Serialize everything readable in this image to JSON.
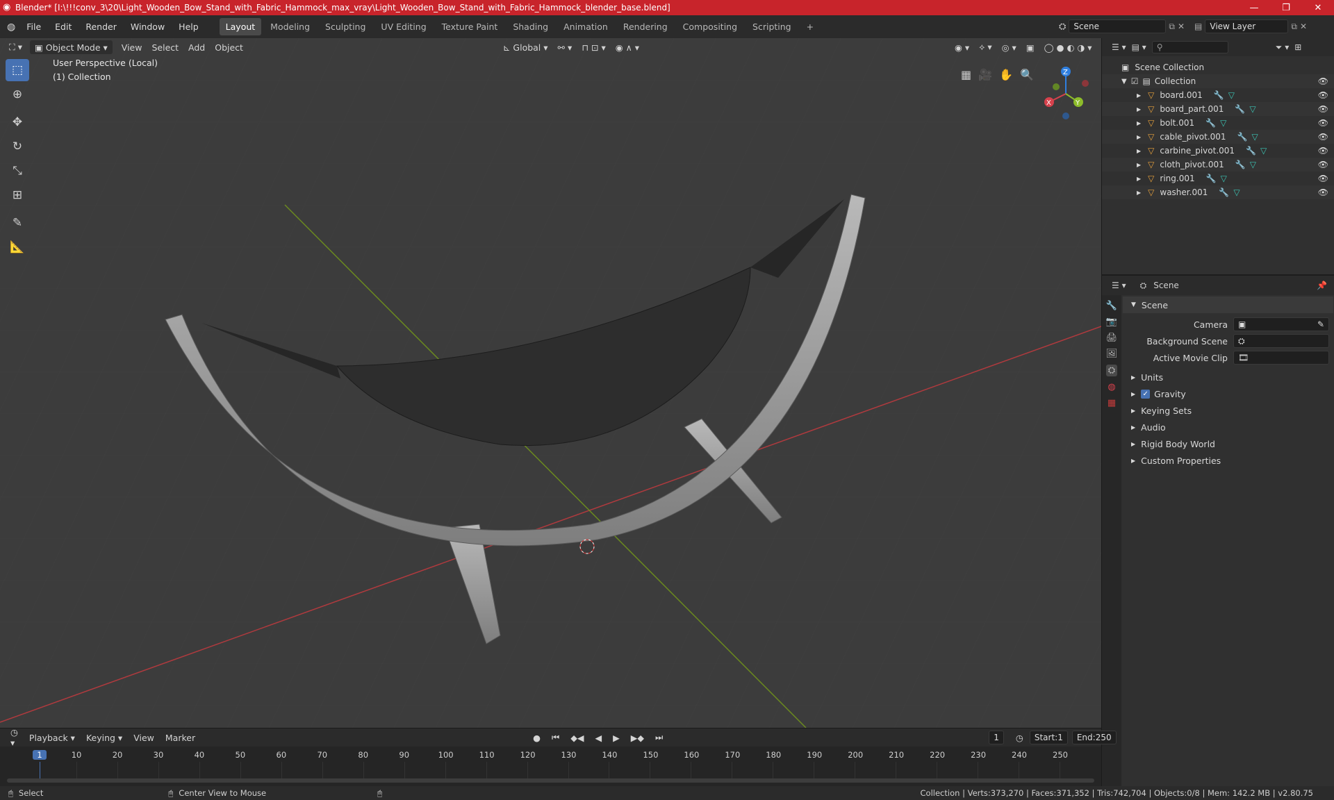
{
  "window": {
    "title": "Blender* [I:\\!!!conv_3\\20\\Light_Wooden_Bow_Stand_with_Fabric_Hammock_max_vray\\Light_Wooden_Bow_Stand_with_Fabric_Hammock_blender_base.blend]",
    "minimize": "—",
    "maximize": "❐",
    "close": "✕"
  },
  "menu": {
    "items": [
      "File",
      "Edit",
      "Render",
      "Window",
      "Help"
    ]
  },
  "workspaces": {
    "tabs": [
      "Layout",
      "Modeling",
      "Sculpting",
      "UV Editing",
      "Texture Paint",
      "Shading",
      "Animation",
      "Rendering",
      "Compositing",
      "Scripting"
    ],
    "active": "Layout",
    "add": "+"
  },
  "topright": {
    "scene": "Scene",
    "view_layer": "View Layer"
  },
  "viewport_header": {
    "mode": "Object Mode",
    "menus": [
      "View",
      "Select",
      "Add",
      "Object"
    ],
    "orientation": "Global"
  },
  "viewport": {
    "perspective": "User Perspective (Local)",
    "collection": "(1) Collection",
    "axes": {
      "x": "X",
      "y": "Y",
      "z": "Z"
    }
  },
  "colors": {
    "accent": "#4772b3",
    "x_axis": "#d6414c",
    "y_axis": "#8dbc2a",
    "z_axis": "#2f7fe0",
    "titlebar": "#c8242b",
    "mesh_icon": "#e8a23c"
  },
  "outliner": {
    "search_placeholder": "",
    "root": "Scene Collection",
    "collection": "Collection",
    "objects": [
      "board.001",
      "board_part.001",
      "bolt.001",
      "cable_pivot.001",
      "carbine_pivot.001",
      "cloth_pivot.001",
      "ring.001",
      "washer.001"
    ]
  },
  "properties": {
    "context": "Scene",
    "section": "Scene",
    "fields": [
      {
        "label": "Camera",
        "value": ""
      },
      {
        "label": "Background Scene",
        "value": ""
      },
      {
        "label": "Active Movie Clip",
        "value": ""
      }
    ],
    "panels": [
      "Units",
      "Gravity",
      "Keying Sets",
      "Audio",
      "Rigid Body World",
      "Custom Properties"
    ],
    "gravity_checked": true
  },
  "timeline": {
    "menus": [
      "Playback",
      "Keying",
      "View",
      "Marker"
    ],
    "current_frame": "1",
    "start_label": "Start:",
    "start": "1",
    "end_label": "End:",
    "end": "250",
    "ticks": [
      "1",
      "10",
      "20",
      "30",
      "40",
      "50",
      "60",
      "70",
      "80",
      "90",
      "100",
      "110",
      "120",
      "130",
      "140",
      "150",
      "160",
      "170",
      "180",
      "190",
      "200",
      "210",
      "220",
      "230",
      "240",
      "250"
    ]
  },
  "status": {
    "select": "Select",
    "center_view": "Center View to Mouse",
    "stats": "Collection | Verts:373,270 | Faces:371,352 | Tris:742,704 | Objects:0/8 | Mem: 142.2 MB | v2.80.75"
  }
}
